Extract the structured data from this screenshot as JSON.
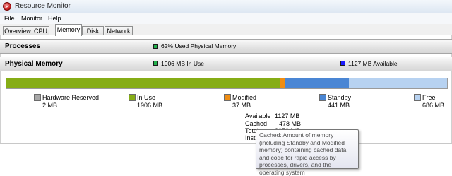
{
  "window": {
    "title": "Resource Monitor"
  },
  "menu": {
    "items": [
      "File",
      "Monitor",
      "Help"
    ]
  },
  "tabs": [
    "Overview",
    "CPU",
    "Memory",
    "Disk",
    "Network"
  ],
  "active_tab": "Memory",
  "processes": {
    "title": "Processes",
    "summary": "62% Used Physical Memory",
    "summary_color": "#22b14c"
  },
  "physical_memory": {
    "title": "Physical Memory",
    "in_use_summary": "1906 MB In Use",
    "in_use_color": "#22b14c",
    "available_summary": "1127 MB Available",
    "available_color": "#1a1aff",
    "bar": [
      {
        "name": "Hardware Reserved",
        "mb": 2,
        "color": "#a0a0a0"
      },
      {
        "name": "In Use",
        "mb": 1906,
        "color": "#86ad16"
      },
      {
        "name": "Modified",
        "mb": 37,
        "color": "#ef8d12"
      },
      {
        "name": "Standby",
        "mb": 441,
        "color": "#4a86d4"
      },
      {
        "name": "Free",
        "mb": 686,
        "color": "#b7d2f1"
      }
    ],
    "legend": [
      {
        "label": "Hardware Reserved",
        "value": "2 MB",
        "color": "#a8a8a8"
      },
      {
        "label": "In Use",
        "value": "1906 MB",
        "color": "#86ad16"
      },
      {
        "label": "Modified",
        "value": "37 MB",
        "color": "#ef8d12"
      },
      {
        "label": "Standby",
        "value": "441 MB",
        "color": "#4a86d4"
      },
      {
        "label": "Free",
        "value": "686 MB",
        "color": "#b7d2f1"
      }
    ],
    "stats": [
      {
        "label": "Available",
        "value": "1127 MB"
      },
      {
        "label": "Cached",
        "value": "478 MB"
      },
      {
        "label": "Total",
        "value": "3070 MB"
      },
      {
        "label": "Insta",
        "value": ""
      }
    ]
  },
  "tooltip": {
    "text": "Cached: Amount of memory (including Standby and Modified memory) containing cached data and code for rapid access by processes, drivers, and the operating system"
  }
}
